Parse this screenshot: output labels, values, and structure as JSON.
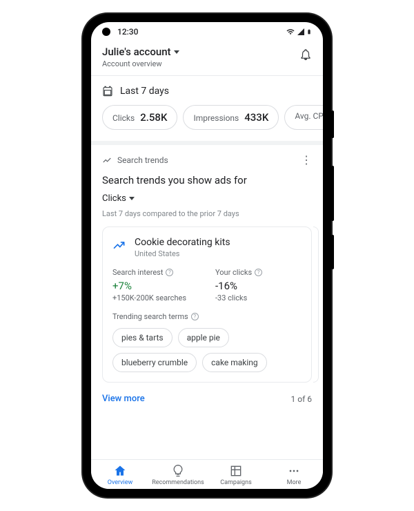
{
  "status": {
    "time": "12:30"
  },
  "header": {
    "account_name": "Julie's account",
    "subtitle": "Account overview"
  },
  "date_range": {
    "label": "Last 7 days"
  },
  "stats": [
    {
      "label": "Clicks",
      "value": "2.58K"
    },
    {
      "label": "Impressions",
      "value": "433K"
    },
    {
      "label": "Avg. CP",
      "value": ""
    }
  ],
  "trends_section": {
    "eyebrow": "Search trends",
    "title": "Search trends you show ads for",
    "metric_selected": "Clicks",
    "compare_text": "Last 7 days compared to the prior 7 days",
    "card": {
      "title": "Cookie decorating kits",
      "region": "United States",
      "search_interest": {
        "label": "Search interest",
        "delta": "+7%",
        "detail": "+150K-200K searches"
      },
      "your_clicks": {
        "label": "Your clicks",
        "delta": "-16%",
        "detail": "-33 clicks"
      },
      "trending_label": "Trending search terms",
      "terms": [
        "pies & tarts",
        "apple pie",
        "blueberry crumble",
        "cake making"
      ]
    },
    "view_more": "View more",
    "pager": "1 of 6"
  },
  "nav": {
    "overview": "Overview",
    "recommendations": "Recommendations",
    "campaigns": "Campaigns",
    "more": "More"
  }
}
